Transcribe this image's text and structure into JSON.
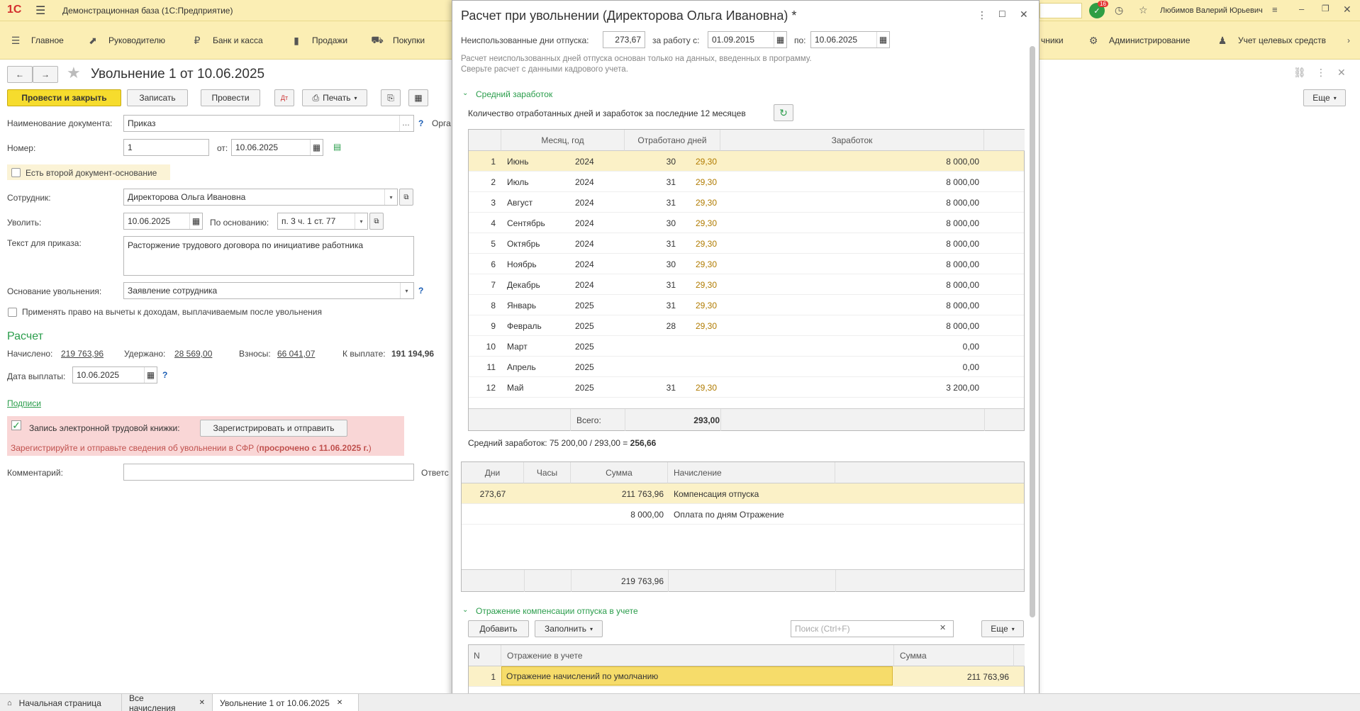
{
  "app": {
    "logo": "1С",
    "title": "Демонстрационная база (1С:Предприятие)",
    "user": "Любимов Валерий Юрьевич",
    "notif_count": "16"
  },
  "nav": {
    "items": [
      "Главное",
      "Руководителю",
      "Банк и касса",
      "Продажи",
      "Покупки",
      "чники",
      "Администрирование",
      "Учет целевых средств"
    ]
  },
  "doc": {
    "title": "Увольнение 1 от 10.06.2025",
    "toolbar": {
      "post_close": "Провести и закрыть",
      "save": "Записать",
      "post": "Провести",
      "print": "Печать",
      "more": "Еще"
    },
    "name_label": "Наименование документа:",
    "name_value": "Приказ",
    "org_label": "Орга",
    "number_label": "Номер:",
    "number_value": "1",
    "date_label": "от:",
    "date_value": "10.06.2025",
    "second_doc_label": "Есть второй документ-основание",
    "employee_label": "Сотрудник:",
    "employee_value": "Директорова Ольга Ивановна",
    "dismiss_label": "Уволить:",
    "dismiss_value": "10.06.2025",
    "basis_label": "По основанию:",
    "basis_value": "п. 3 ч. 1 ст. 77",
    "order_text_label": "Текст для приказа:",
    "order_text_value": "Расторжение трудового договора по инициативе работника",
    "reason_label": "Основание увольнения:",
    "reason_value": "Заявление сотрудника",
    "deduction_label": "Применять право на вычеты к доходам, выплачиваемым после увольнения",
    "calc_header": "Расчет",
    "accrued_label": "Начислено:",
    "accrued_value": "219 763,96",
    "withheld_label": "Удержано:",
    "withheld_value": "28 569,00",
    "contrib_label": "Взносы:",
    "contrib_value": "66 041,07",
    "topay_label": "К выплате:",
    "topay_value": "191 194,96",
    "paydate_label": "Дата выплаты:",
    "paydate_value": "10.06.2025",
    "signatures_link": "Подписи",
    "etk_label": "Запись электронной трудовой книжки:",
    "etk_button": "Зарегистрировать и отправить",
    "etk_warning_a": "Зарегистрируйте и отправьте сведения об увольнении в СФР (",
    "etk_warning_b": "просрочено с 11.06.2025 г.",
    "etk_warning_c": ")",
    "comment_label": "Комментарий:",
    "resp_label": "Ответс"
  },
  "dialog": {
    "title": "Расчет при увольнении (Директорова Ольга Ивановна) *",
    "unused_label": "Неиспользованные дни отпуска:",
    "unused_value": "273,67",
    "period_label": "за работу с:",
    "period_from": "01.09.2015",
    "period_to_label": "по:",
    "period_to": "10.06.2025",
    "note_line1": "Расчет неиспользованных дней отпуска основан только на данных, введенных в программу.",
    "note_line2": "Сверьте расчет с данными кадрового учета.",
    "avg_section": "Средний заработок",
    "months_caption": "Количество отработанных дней и заработок за последние 12 месяцев",
    "months_headers": {
      "month": "Месяц, год",
      "days": "Отработано дней",
      "earn": "Заработок"
    },
    "months": [
      {
        "n": "1",
        "m": "Июнь",
        "y": "2024",
        "d": "30",
        "k": "29,30",
        "e": "8 000,00"
      },
      {
        "n": "2",
        "m": "Июль",
        "y": "2024",
        "d": "31",
        "k": "29,30",
        "e": "8 000,00"
      },
      {
        "n": "3",
        "m": "Август",
        "y": "2024",
        "d": "31",
        "k": "29,30",
        "e": "8 000,00"
      },
      {
        "n": "4",
        "m": "Сентябрь",
        "y": "2024",
        "d": "30",
        "k": "29,30",
        "e": "8 000,00"
      },
      {
        "n": "5",
        "m": "Октябрь",
        "y": "2024",
        "d": "31",
        "k": "29,30",
        "e": "8 000,00"
      },
      {
        "n": "6",
        "m": "Ноябрь",
        "y": "2024",
        "d": "30",
        "k": "29,30",
        "e": "8 000,00"
      },
      {
        "n": "7",
        "m": "Декабрь",
        "y": "2024",
        "d": "31",
        "k": "29,30",
        "e": "8 000,00"
      },
      {
        "n": "8",
        "m": "Январь",
        "y": "2025",
        "d": "31",
        "k": "29,30",
        "e": "8 000,00"
      },
      {
        "n": "9",
        "m": "Февраль",
        "y": "2025",
        "d": "28",
        "k": "29,30",
        "e": "8 000,00"
      },
      {
        "n": "10",
        "m": "Март",
        "y": "2025",
        "d": "",
        "k": "",
        "e": "0,00"
      },
      {
        "n": "11",
        "m": "Апрель",
        "y": "2025",
        "d": "",
        "k": "",
        "e": "0,00"
      },
      {
        "n": "12",
        "m": "Май",
        "y": "2025",
        "d": "31",
        "k": "29,30",
        "e": "3 200,00"
      }
    ],
    "months_total_label": "Всего:",
    "months_total_value": "293,00",
    "avg_formula_a": "Средний заработок: 75 200,00 / 293,00 = ",
    "avg_formula_b": "256,66",
    "accr_headers": {
      "days": "Дни",
      "hours": "Часы",
      "sum": "Сумма",
      "accrual": "Начисление"
    },
    "accruals": [
      {
        "days": "273,67",
        "hours": "",
        "sum": "211 763,96",
        "name": "Компенсация отпуска"
      },
      {
        "days": "",
        "hours": "",
        "sum": "8 000,00",
        "name": "Оплата по дням Отражение"
      }
    ],
    "accr_total": "219 763,96",
    "refl_section": "Отражение компенсации отпуска в учете",
    "refl_add": "Добавить",
    "refl_fill": "Заполнить",
    "refl_search_placeholder": "Поиск (Ctrl+F)",
    "refl_more": "Еще",
    "refl_headers": {
      "n": "N",
      "name": "Отражение в учете",
      "sum": "Сумма"
    },
    "refl_rows": [
      {
        "n": "1",
        "name": "Отражение начислений по умолчанию",
        "sum": "211 763,96"
      }
    ]
  },
  "tabs": {
    "home": "Начальная страница",
    "t1": "Все начисления",
    "t2": "Увольнение 1 от 10.06.2025"
  }
}
